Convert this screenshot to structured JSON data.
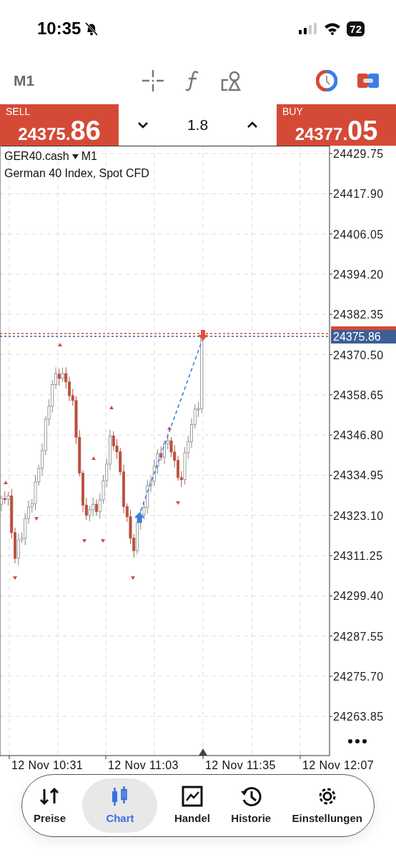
{
  "status_bar": {
    "time": "10:35",
    "battery": "72"
  },
  "toolbar": {
    "timeframe": "M1"
  },
  "trade_bar": {
    "sell": {
      "label": "SELL",
      "price_small": "24375.",
      "price_big": "86"
    },
    "spread": {
      "value": "1.8"
    },
    "buy": {
      "label": "BUY",
      "price_small": "24377.",
      "price_big": "05"
    }
  },
  "chart": {
    "symbol": "GER40.cash",
    "timeframe": "M1",
    "description": "German 40 Index, Spot CFD",
    "y_axis_labels": [
      "24429.75",
      "24417.90",
      "24406.05",
      "24394.20",
      "24382.35",
      "24370.50",
      "24358.65",
      "24346.80",
      "24334.95",
      "24323.10",
      "24311.25",
      "24299.40",
      "24287.55",
      "24275.70",
      "24263.85"
    ],
    "bid_tag": "24375.86",
    "x_axis_labels": [
      "12 Nov 10:31",
      "12 Nov 11:03",
      "12 Nov 11:35",
      "12 Nov 12:07"
    ]
  },
  "bottom_nav": [
    {
      "label": "Preise",
      "selected": false
    },
    {
      "label": "Chart",
      "selected": true
    },
    {
      "label": "Handel",
      "selected": false
    },
    {
      "label": "Historie",
      "selected": false
    },
    {
      "label": "Einstellungen",
      "selected": false
    }
  ]
}
